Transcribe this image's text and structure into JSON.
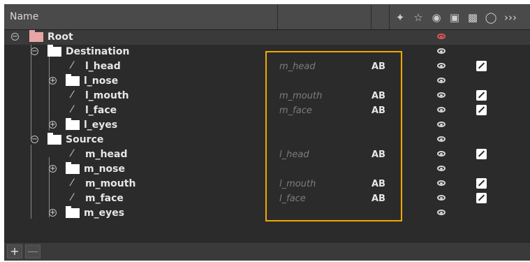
{
  "header": {
    "name_label": "Name",
    "icons": [
      "add-point-icon",
      "pin-icon",
      "eye-icon",
      "lock-icon",
      "lock-box-icon",
      "ellipse-icon",
      "more-columns-icon"
    ]
  },
  "tree": {
    "nodes": [
      {
        "label": "Root",
        "type": "folder",
        "eye": "red"
      },
      {
        "label": "Destination",
        "type": "folder"
      },
      {
        "label": "l_head",
        "type": "curve",
        "mapping": "m_head",
        "ab": "AB",
        "locked": true
      },
      {
        "label": "l_nose",
        "type": "folder"
      },
      {
        "label": "l_mouth",
        "type": "curve",
        "mapping": "m_mouth",
        "ab": "AB",
        "locked": true
      },
      {
        "label": "l_face",
        "type": "curve",
        "mapping": "m_face",
        "ab": "AB",
        "locked": true
      },
      {
        "label": "l_eyes",
        "type": "folder"
      },
      {
        "label": "Source",
        "type": "folder"
      },
      {
        "label": "m_head",
        "type": "curve",
        "mapping": "l_head",
        "ab": "AB",
        "locked": true
      },
      {
        "label": "m_nose",
        "type": "folder"
      },
      {
        "label": "m_mouth",
        "type": "curve",
        "mapping": "l_mouth",
        "ab": "AB",
        "locked": true
      },
      {
        "label": "m_face",
        "type": "curve",
        "mapping": "l_face",
        "ab": "AB",
        "locked": true
      },
      {
        "label": "m_eyes",
        "type": "folder"
      }
    ]
  },
  "footer": {
    "add_label": "+",
    "remove_label": "—"
  },
  "colors": {
    "highlight": "#f2a900",
    "root_folder": "#e8a5a5",
    "root_eye": "#e05555"
  }
}
